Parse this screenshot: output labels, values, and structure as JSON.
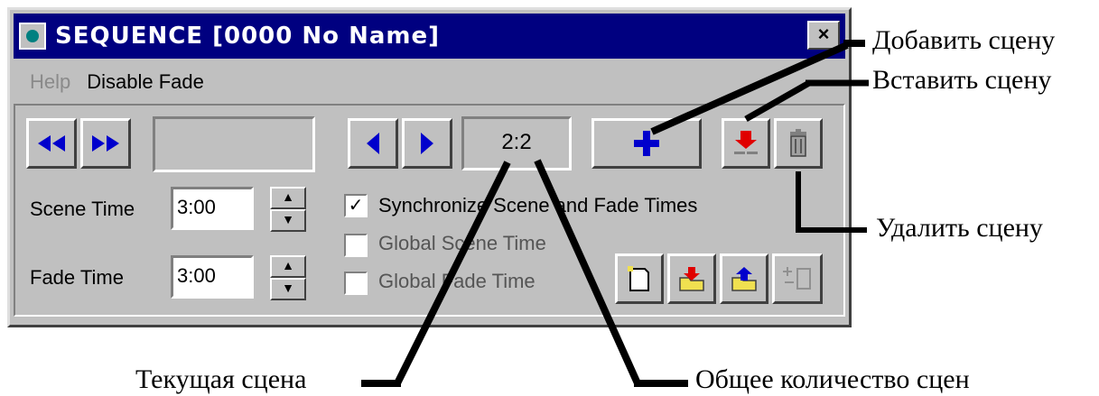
{
  "window": {
    "title": "SEQUENCE [0000 No Name]",
    "close_glyph": "×"
  },
  "menu": {
    "help": "Help",
    "disable_fade": "Disable Fade"
  },
  "nav": {
    "scene_counter": "2:2"
  },
  "scene_time": {
    "label": "Scene Time",
    "value": "3:00"
  },
  "fade_time": {
    "label": "Fade Time",
    "value": "3:00"
  },
  "options": {
    "sync": {
      "label": "Synchronize Scene and Fade Times",
      "checked": true,
      "mark": "✓"
    },
    "global_scene": {
      "label": "Global Scene Time",
      "checked": false
    },
    "global_fade": {
      "label": "Global Fade Time",
      "checked": false
    }
  },
  "callouts": {
    "add_scene": "Добавить сцену",
    "insert_scene": "Вставить сцену",
    "delete_scene": "Удалить сцену",
    "current_scene": "Текущая сцена",
    "total_scenes": "Общее количество сцен"
  },
  "colors": {
    "title_bar": "#000080",
    "face": "#c0c0c0",
    "arrow_blue": "#0000cc",
    "red": "#e00000",
    "folder_yellow": "#f0e050"
  },
  "icons": [
    "rewind-icon",
    "fast-forward-icon",
    "prev-scene-icon",
    "next-scene-icon",
    "add-scene-icon",
    "insert-scene-icon",
    "trash-icon",
    "new-file-icon",
    "open-file-icon",
    "save-file-icon",
    "fade-list-icon"
  ]
}
